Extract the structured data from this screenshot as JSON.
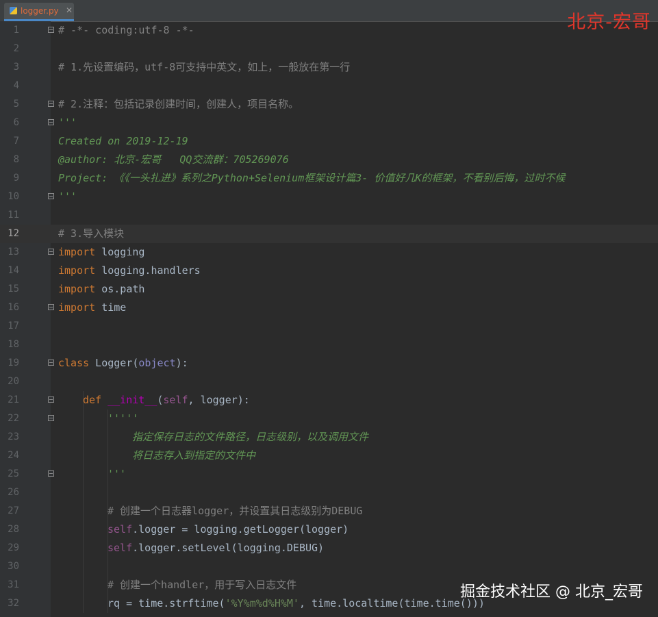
{
  "tab": {
    "icon": "python-file-icon",
    "label": "logger.py",
    "close": "✕"
  },
  "watermarks": {
    "top": "北京-宏哥",
    "bottom": "掘金技术社区 @ 北京_宏哥"
  },
  "colors": {
    "background": "#2b2b2b",
    "comment": "#808080",
    "docstring": "#629755",
    "keyword": "#cc7832",
    "self": "#94558d",
    "watermark": "#e0362b"
  },
  "editor": {
    "current_line": 12,
    "lines": [
      {
        "n": "1",
        "fold": true,
        "indent": 85,
        "segs": [
          {
            "t": "# -*- coding:utf-8 -*-",
            "c": "c-comment"
          }
        ]
      },
      {
        "n": "2",
        "indent": 85,
        "segs": []
      },
      {
        "n": "3",
        "indent": 85,
        "segs": [
          {
            "t": "# 1.先设置编码，utf-8可支持中英文，如上，一般放在第一行",
            "c": "c-comment"
          }
        ]
      },
      {
        "n": "4",
        "indent": 85,
        "segs": []
      },
      {
        "n": "5",
        "fold": true,
        "indent": 85,
        "segs": [
          {
            "t": "# 2.注释：包括记录创建时间，创建人，项目名称。",
            "c": "c-comment"
          }
        ]
      },
      {
        "n": "6",
        "fold": true,
        "indent": 85,
        "segs": [
          {
            "t": "'''",
            "c": "c-doc"
          }
        ]
      },
      {
        "n": "7",
        "indent": 85,
        "segs": [
          {
            "t": "Created on 2019-12-19",
            "c": "c-doc"
          }
        ]
      },
      {
        "n": "8",
        "indent": 85,
        "segs": [
          {
            "t": "@author: 北京-宏哥   QQ交流群：705269076",
            "c": "c-doc"
          }
        ]
      },
      {
        "n": "9",
        "indent": 85,
        "segs": [
          {
            "t": "Project: 《《一头扎进》系列之Python+Selenium框架设计篇3- 价值好几K的框架，不看别后悔，过时不候",
            "c": "c-doc"
          }
        ]
      },
      {
        "n": "10",
        "fold": true,
        "indent": 85,
        "segs": [
          {
            "t": "'''",
            "c": "c-doc"
          }
        ]
      },
      {
        "n": "11",
        "indent": 85,
        "segs": []
      },
      {
        "n": "12",
        "indent": 85,
        "segs": [
          {
            "t": "# 3.导入模块",
            "c": "c-comment"
          }
        ]
      },
      {
        "n": "13",
        "fold": true,
        "indent": 85,
        "segs": [
          {
            "t": "import",
            "c": "c-kw"
          },
          {
            "t": " logging",
            "c": ""
          }
        ]
      },
      {
        "n": "14",
        "indent": 85,
        "segs": [
          {
            "t": "import",
            "c": "c-kw"
          },
          {
            "t": " logging.handlers",
            "c": ""
          }
        ]
      },
      {
        "n": "15",
        "indent": 85,
        "segs": [
          {
            "t": "import",
            "c": "c-kw"
          },
          {
            "t": " os.path",
            "c": ""
          }
        ]
      },
      {
        "n": "16",
        "fold": true,
        "indent": 85,
        "segs": [
          {
            "t": "import",
            "c": "c-kw"
          },
          {
            "t": " time",
            "c": ""
          }
        ]
      },
      {
        "n": "17",
        "indent": 85,
        "segs": []
      },
      {
        "n": "18",
        "indent": 85,
        "segs": []
      },
      {
        "n": "19",
        "fold": true,
        "indent": 85,
        "segs": [
          {
            "t": "class",
            "c": "c-kw"
          },
          {
            "t": " Logger(",
            "c": ""
          },
          {
            "t": "object",
            "c": "c-builtin"
          },
          {
            "t": "):",
            "c": ""
          }
        ]
      },
      {
        "n": "20",
        "indent": 85,
        "segs": []
      },
      {
        "n": "21",
        "fold": true,
        "indent": 121,
        "segs": [
          {
            "t": "def",
            "c": "c-kw"
          },
          {
            "t": " ",
            "c": ""
          },
          {
            "t": "__init__",
            "c": "c-magic"
          },
          {
            "t": "(",
            "c": ""
          },
          {
            "t": "self",
            "c": "c-self"
          },
          {
            "t": ", logger):",
            "c": ""
          }
        ]
      },
      {
        "n": "22",
        "fold": true,
        "indent": 157,
        "segs": [
          {
            "t": "'''''",
            "c": "c-doc"
          }
        ]
      },
      {
        "n": "23",
        "indent": 193,
        "segs": [
          {
            "t": "指定保存日志的文件路径，日志级别，以及调用文件",
            "c": "c-doc"
          }
        ]
      },
      {
        "n": "24",
        "indent": 193,
        "segs": [
          {
            "t": "将日志存入到指定的文件中",
            "c": "c-doc"
          }
        ]
      },
      {
        "n": "25",
        "fold": true,
        "indent": 157,
        "segs": [
          {
            "t": "'''",
            "c": "c-doc"
          }
        ]
      },
      {
        "n": "26",
        "indent": 157,
        "segs": []
      },
      {
        "n": "27",
        "indent": 157,
        "segs": [
          {
            "t": "# 创建一个日志器logger，并设置其日志级别为DEBUG",
            "c": "c-comment"
          }
        ]
      },
      {
        "n": "28",
        "indent": 157,
        "segs": [
          {
            "t": "self",
            "c": "c-self"
          },
          {
            "t": ".logger = logging.getLogger(logger)",
            "c": ""
          }
        ]
      },
      {
        "n": "29",
        "indent": 157,
        "segs": [
          {
            "t": "self",
            "c": "c-self"
          },
          {
            "t": ".logger.setLevel(logging.DEBUG)",
            "c": ""
          }
        ]
      },
      {
        "n": "30",
        "indent": 157,
        "segs": []
      },
      {
        "n": "31",
        "indent": 157,
        "segs": [
          {
            "t": "# 创建一个handler，用于写入日志文件",
            "c": "c-comment"
          }
        ]
      },
      {
        "n": "32",
        "indent": 157,
        "segs": [
          {
            "t": "rq = time.strftime(",
            "c": ""
          },
          {
            "t": "'%Y%m%d%H%M'",
            "c": "c-str"
          },
          {
            "t": ", time.localtime(time.time()))",
            "c": ""
          }
        ]
      }
    ]
  }
}
